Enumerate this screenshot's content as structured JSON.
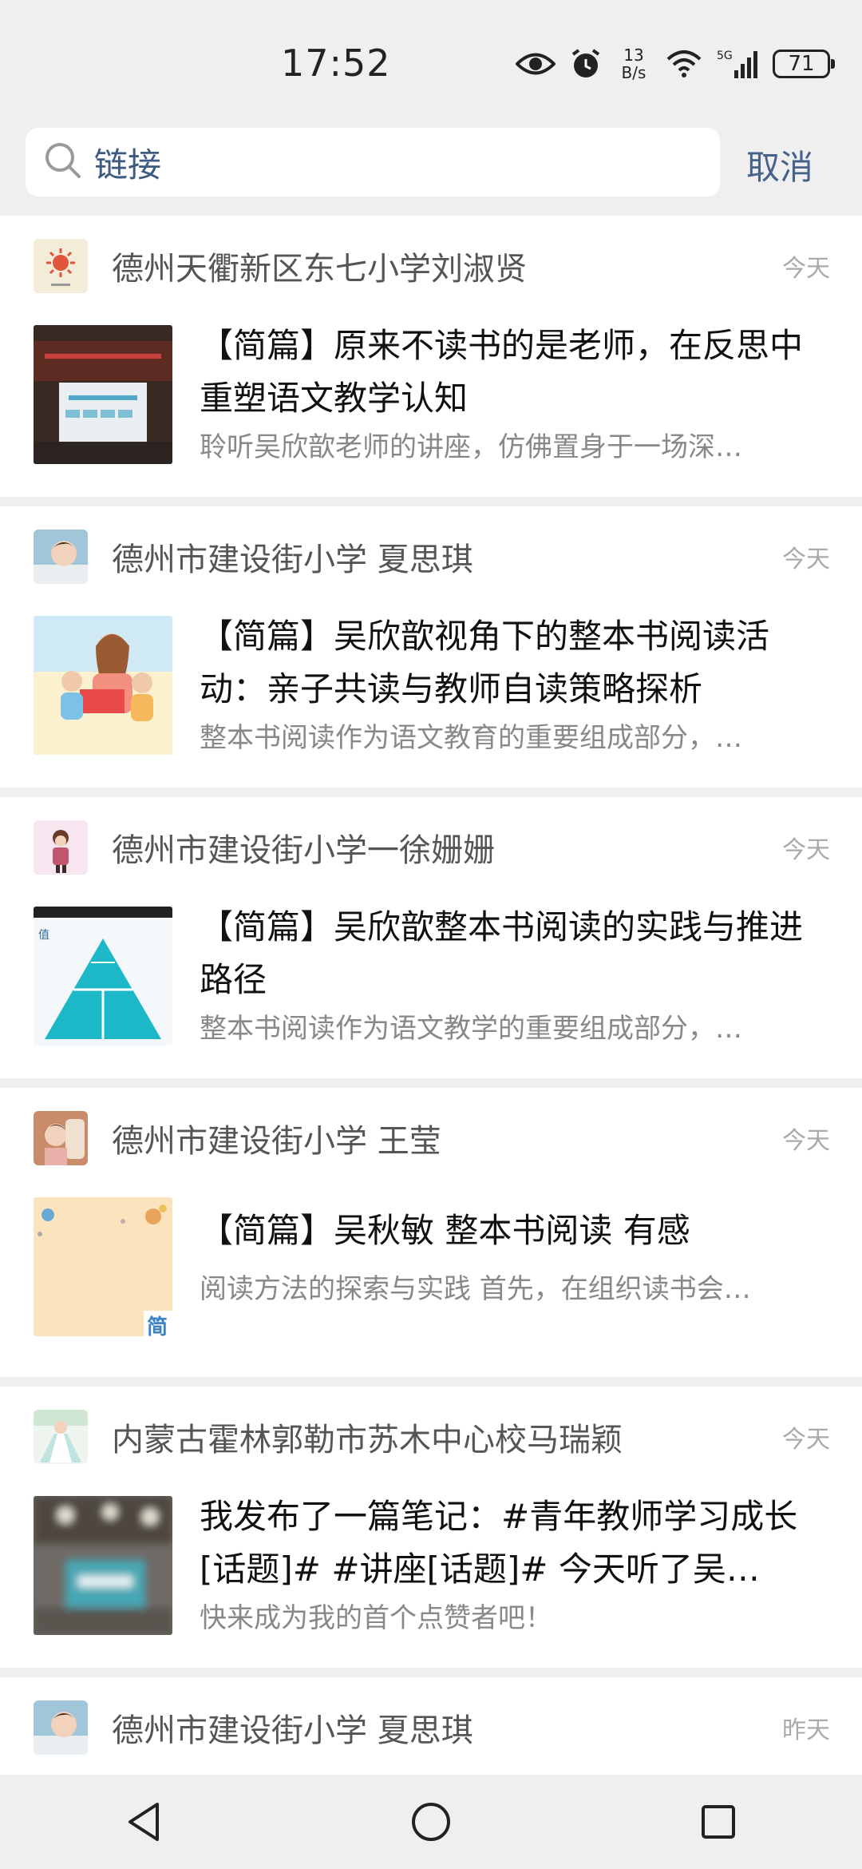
{
  "status_bar": {
    "time": "17:52",
    "net_speed_value": "13",
    "net_speed_unit": "B/s",
    "network": "5G",
    "battery": "71",
    "icons": [
      "eye-icon",
      "alarm-icon",
      "wifi-icon",
      "signal-icon",
      "battery-icon"
    ]
  },
  "search": {
    "value": "链接",
    "cancel_label": "取消"
  },
  "feed": [
    {
      "author": "德州天衢新区东七小学刘淑贤",
      "date": "今天",
      "title": "【简篇】原来不读书的是老师，在反思中重塑语文教学认知",
      "summary": "聆听吴欣歆老师的讲座，仿佛置身于一场深…"
    },
    {
      "author": "德州市建设街小学 夏思琪",
      "date": "今天",
      "title": "【简篇】吴欣歆视角下的整本书阅读活动：亲子共读与教师自读策略探析",
      "summary": "整本书阅读作为语文教育的重要组成部分，…"
    },
    {
      "author": "德州市建设街小学一徐姗姗",
      "date": "今天",
      "title": "【简篇】吴欣歆整本书阅读的实践与推进路径",
      "summary": "整本书阅读作为语文教学的重要组成部分，…"
    },
    {
      "author": "德州市建设街小学 王莹",
      "date": "今天",
      "title": "【简篇】吴秋敏 整本书阅读 有感",
      "summary": "阅读方法的探索与实践 首先，在组织读书会…",
      "thumb_badge": "简"
    },
    {
      "author": "内蒙古霍林郭勒市苏木中心校马瑞颖",
      "date": "今天",
      "title": "我发布了一篇笔记：#青年教师学习成长[话题]# #讲座[话题]# 今天听了吴…",
      "summary": "快来成为我的首个点赞者吧！"
    },
    {
      "author": "德州市建设街小学 夏思琪",
      "date": "昨天"
    }
  ],
  "colors": {
    "background": "#efefef",
    "card": "#ffffff",
    "link_blue": "#46628a"
  }
}
